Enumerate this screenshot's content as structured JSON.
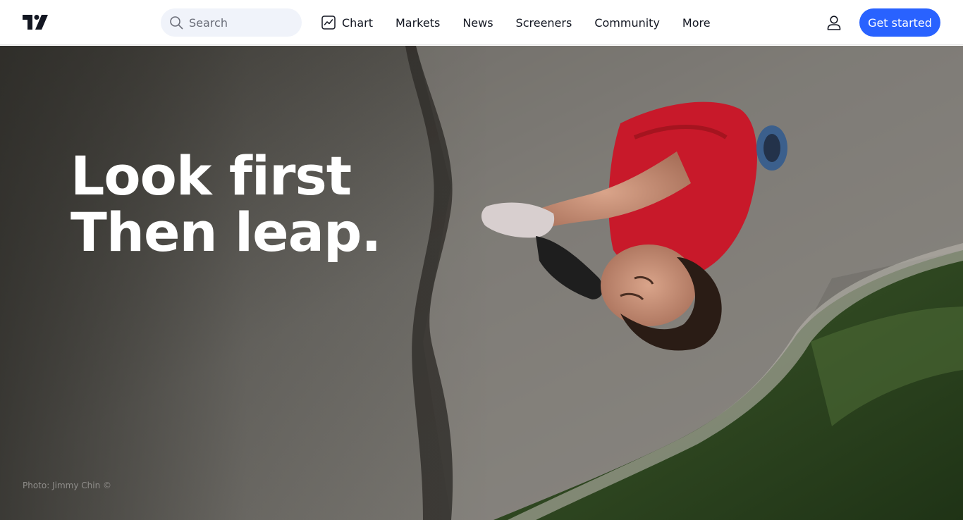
{
  "header": {
    "logo_icon": "tradingview-logo-icon",
    "search": {
      "placeholder": "Search",
      "icon": "search-icon"
    },
    "nav": [
      {
        "label": "Chart",
        "icon": "chart-icon"
      },
      {
        "label": "Markets"
      },
      {
        "label": "News"
      },
      {
        "label": "Screeners"
      },
      {
        "label": "Community"
      },
      {
        "label": "More"
      }
    ],
    "user_icon": "user-icon",
    "cta_label": "Get started"
  },
  "hero": {
    "title_line1": "Look first",
    "title_line2": "Then leap.",
    "photo_credit": "Photo: Jimmy Chin ©"
  },
  "colors": {
    "accent": "#2962ff",
    "text": "#131722",
    "search_bg": "#f0f3fa",
    "shirt_red": "#c8192a",
    "rock": "#7a7874",
    "forest": "#2f4a22"
  }
}
